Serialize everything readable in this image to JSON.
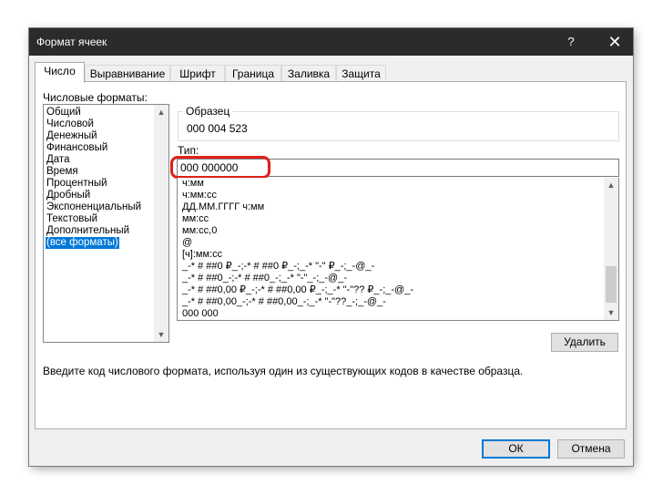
{
  "window": {
    "title": "Формат ячеек",
    "help_label": "?",
    "close_label": "✕"
  },
  "tabs": [
    {
      "label": "Число",
      "active": true
    },
    {
      "label": "Выравнивание",
      "active": false
    },
    {
      "label": "Шрифт",
      "active": false
    },
    {
      "label": "Граница",
      "active": false
    },
    {
      "label": "Заливка",
      "active": false
    },
    {
      "label": "Защита",
      "active": false
    }
  ],
  "categories": {
    "label": "Числовые форматы:",
    "items": [
      "Общий",
      "Числовой",
      "Денежный",
      "Финансовый",
      "Дата",
      "Время",
      "Процентный",
      "Дробный",
      "Экспоненциальный",
      "Текстовый",
      "Дополнительный",
      "(все форматы)"
    ],
    "selected": "(все форматы)"
  },
  "sample": {
    "label": "Образец",
    "value": "000 004 523"
  },
  "type": {
    "label": "Тип:",
    "value": "000 000000"
  },
  "formats": [
    "ч:мм",
    "ч:мм:сс",
    "ДД.ММ.ГГГГ ч:мм",
    "мм:сс",
    "мм:сс,0",
    "@",
    "[ч]:мм:сс",
    "_-* # ##0 ₽_-;-* # ##0 ₽_-;_-* \"-\" ₽_-;_-@_-",
    "_-* # ##0_-;-* # ##0_-;_-* \"-\"_-;_-@_-",
    "_-* # ##0,00 ₽_-;-* # ##0,00 ₽_-;_-* \"-\"?? ₽_-;_-@_-",
    "_-* # ##0,00_-;-* # ##0,00_-;_-* \"-\"??_-;_-@_-",
    "000 000"
  ],
  "delete_button": "Удалить",
  "hint": "Введите код числового формата, используя один из существующих кодов в качестве образца.",
  "ok_button": "ОК",
  "cancel_button": "Отмена",
  "colors": {
    "titlebar": "#2b2b2b",
    "selection": "#0078d7",
    "highlight": "#e0201b"
  }
}
